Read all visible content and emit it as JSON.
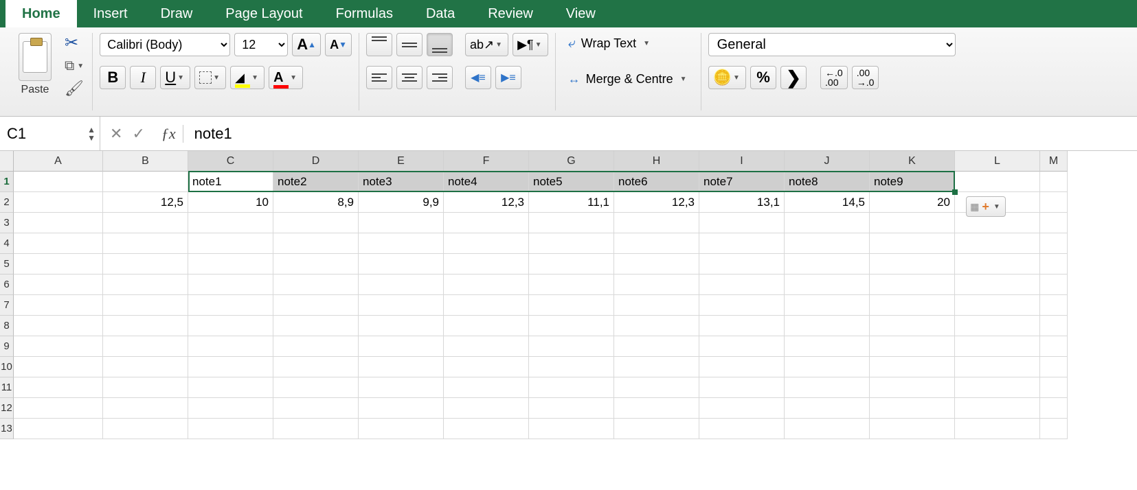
{
  "tabs": [
    "Home",
    "Insert",
    "Draw",
    "Page Layout",
    "Formulas",
    "Data",
    "Review",
    "View"
  ],
  "active_tab": 0,
  "clipboard": {
    "paste": "Paste"
  },
  "font": {
    "name": "Calibri (Body)",
    "size": "12",
    "bold": "B",
    "italic": "I",
    "underline": "U",
    "grow": "A",
    "shrink": "A"
  },
  "align": {
    "wrap": "Wrap Text",
    "merge": "Merge & Centre"
  },
  "number": {
    "format": "General",
    "percent": "%",
    "comma": "❯",
    "inc": ".0\n.00",
    "dec": ".00\n→.0"
  },
  "namebox": "C1",
  "fx_label": "ƒx",
  "formula_value": "note1",
  "columns": [
    "A",
    "B",
    "C",
    "D",
    "E",
    "F",
    "G",
    "H",
    "I",
    "J",
    "K",
    "L",
    "M"
  ],
  "selected_cols": [
    "C",
    "D",
    "E",
    "F",
    "G",
    "H",
    "I",
    "J",
    "K"
  ],
  "rows": [
    1,
    2,
    3,
    4,
    5,
    6,
    7,
    8,
    9,
    10,
    11,
    12,
    13
  ],
  "selected_row": 1,
  "data_row1": {
    "C": "note1",
    "D": "note2",
    "E": "note3",
    "F": "note4",
    "G": "note5",
    "H": "note6",
    "I": "note7",
    "J": "note8",
    "K": "note9"
  },
  "data_row2": {
    "B": "12,5",
    "C": "10",
    "D": "8,9",
    "E": "9,9",
    "F": "12,3",
    "G": "11,1",
    "H": "12,3",
    "I": "13,1",
    "J": "14,5",
    "K": "20"
  }
}
